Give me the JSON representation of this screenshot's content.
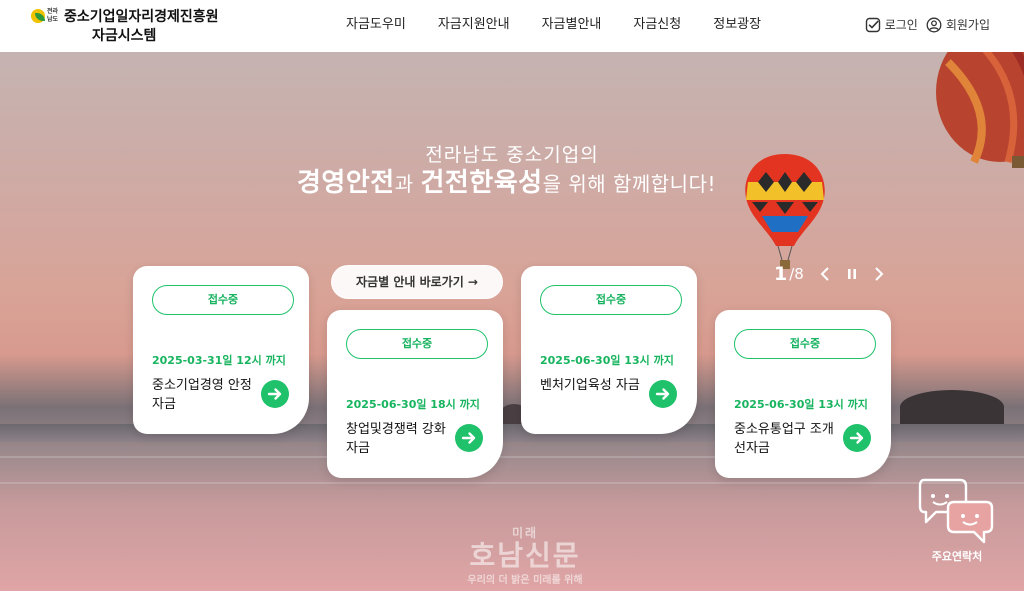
{
  "header": {
    "logo": {
      "emblem_text": "전라남도",
      "line1": "중소기업일자리경제진흥원",
      "line2": "자금시스템"
    },
    "nav": [
      "자금도우미",
      "자금지원안내",
      "자금별안내",
      "자금신청",
      "정보광장"
    ],
    "util": {
      "login": "로그인",
      "signup": "회원가입"
    }
  },
  "hero": {
    "headline_line1": "전라남도 중소기업의",
    "headline_line2": {
      "bold1": "경영안전",
      "part1": "과 ",
      "bold2": "건전한육성",
      "part2": "을 위해 함께합니다!"
    },
    "guide_button": "자금별 안내 바로가기 →",
    "pager": {
      "current": "1",
      "total": "/8"
    }
  },
  "cards": [
    {
      "status": "접수중",
      "deadline": "2025-03-31일 12시 까지",
      "title": "중소기업경영 안정자금"
    },
    {
      "status": "접수중",
      "deadline": "2025-06-30일 18시 까지",
      "title": "창업및경쟁력 강화자금"
    },
    {
      "status": "접수중",
      "deadline": "2025-06-30일 13시 까지",
      "title": "벤처기업육성 자금"
    },
    {
      "status": "접수중",
      "deadline": "2025-06-30일 13시 까지",
      "title": "중소유통업구 조개선자금"
    }
  ],
  "contact": {
    "label": "주요연락처"
  },
  "watermark": {
    "line1": "미래",
    "line2": "호남신문",
    "line3": "우리의 더 밝은 미래를 위해"
  },
  "colors": {
    "accent_green": "#1fc16b",
    "header_bg": "#ffffff"
  },
  "icons": [
    "check-square-icon",
    "user-circle-icon",
    "arrow-right-icon",
    "chevron-left-icon",
    "pause-icon",
    "chevron-right-icon",
    "chat-bubbles-icon"
  ]
}
